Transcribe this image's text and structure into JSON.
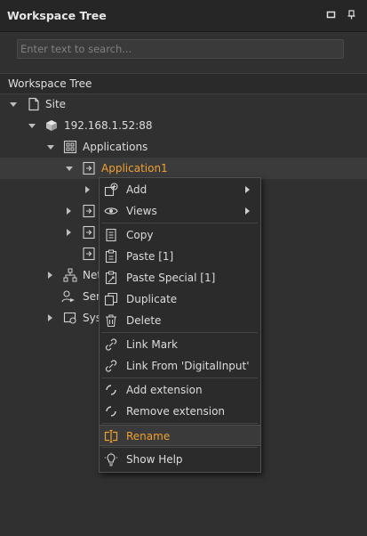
{
  "window": {
    "title": "Workspace Tree"
  },
  "search": {
    "placeholder": "Enter text to search..."
  },
  "tree": {
    "header": "Workspace Tree",
    "site": "Site",
    "ip": "192.168.1.52:88",
    "applications": "Applications",
    "application1": "Application1",
    "net_partial": "Net",
    "ser_partial": "Ser",
    "sys_partial": "Sys"
  },
  "menu": {
    "add": "Add",
    "views": "Views",
    "copy": "Copy",
    "paste": "Paste [1]",
    "paste_special": "Paste Special [1]",
    "duplicate": "Duplicate",
    "delete": "Delete",
    "link_mark": "Link Mark",
    "link_from": "Link From 'DigitalInput'",
    "add_extension": "Add extension",
    "remove_extension": "Remove extension",
    "rename": "Rename",
    "show_help": "Show Help"
  },
  "colors": {
    "accent": "#f0a030",
    "background": "#303030",
    "text": "#dcdcdc"
  }
}
